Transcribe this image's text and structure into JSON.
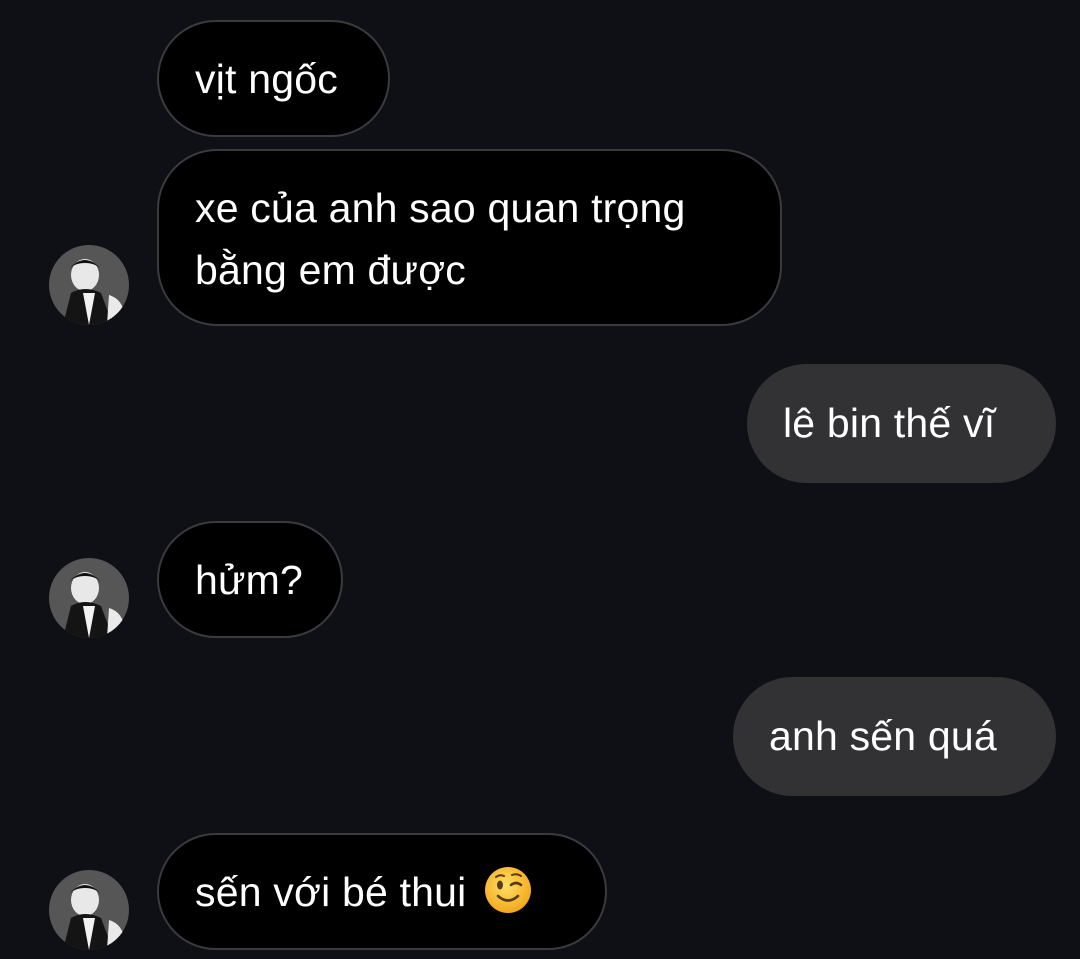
{
  "messages": [
    {
      "sender": "other",
      "text": "vịt ngốc"
    },
    {
      "sender": "other",
      "text": "xe của anh sao quan trọng bằng em được"
    },
    {
      "sender": "me",
      "text": "lê bin thế vĩ"
    },
    {
      "sender": "other",
      "text": "hửm?"
    },
    {
      "sender": "me",
      "text": "anh sến quá"
    },
    {
      "sender": "other",
      "text": "sến với bé thui",
      "emoji": "winking-face-emoji"
    }
  ],
  "colors": {
    "background": "#0f1016",
    "incoming_bubble": "#000000",
    "incoming_border": "#3a3a3f",
    "outgoing_bubble": "#323235",
    "text": "#ffffff"
  },
  "icons": {
    "avatar": "contact-avatar-photo",
    "emoji": "winking-face-emoji"
  }
}
